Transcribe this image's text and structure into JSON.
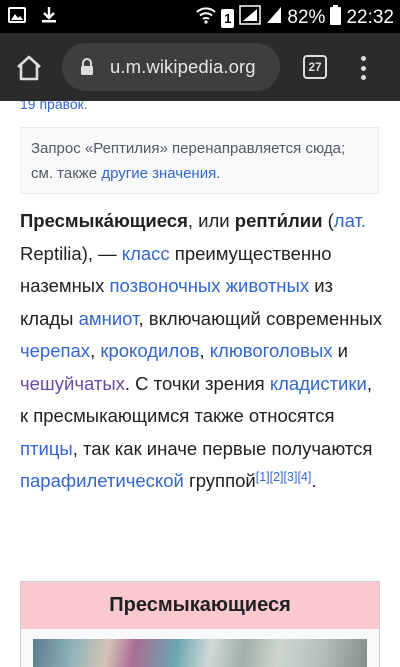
{
  "status_bar": {
    "battery": "82%",
    "time": "22:32",
    "sim": "1"
  },
  "browser": {
    "url": "u.m.wikipedia.org",
    "tab_count": "27"
  },
  "article": {
    "edits_link": "19 правок.",
    "hatnote": {
      "text": "Запрос «Рептилия» перенаправляется сюда; см. также ",
      "link": "другие значения",
      "end": "."
    },
    "para": {
      "t1": "Пресмыка́ющиеся",
      "t2": ", или ",
      "t3": "репти́лии",
      "t4": " (",
      "l_lat": "лат.",
      "t5": " Reptilia), — ",
      "l_class": "класс",
      "t6": " преимущественно наземных ",
      "l_vertebrates": "позвоночных животных",
      "t7": " из клады ",
      "l_amniotes": "амниот",
      "t8": ", включающий современных ",
      "l_turtles": "черепах",
      "t9": ", ",
      "l_crocodiles": "крокодилов",
      "t10": ", ",
      "l_rhynch": "клювоголовых",
      "t11": " и ",
      "l_squamata": "чешуйчатых",
      "t12": ". С точки зрения ",
      "l_cladistics": "кладистики",
      "t13": ", к пресмыкающимся также относятся ",
      "l_birds": "птицы",
      "t14": ", так как иначе первые получаются ",
      "l_paraphyletic": "парафилетической",
      "t15": " группой",
      "refs": [
        "[1]",
        "[2]",
        "[3]",
        "[4]"
      ],
      "t16": "."
    },
    "infobox_title": "Пресмыкающиеся"
  },
  "colors": {
    "link": "#3366cc",
    "visited_link": "#6b4ba1",
    "infobox_header": "#f9c9cf"
  },
  "icons": [
    "photo-icon",
    "download-icon",
    "wifi-icon",
    "sim-icon",
    "signal-icon",
    "battery-icon",
    "home-icon",
    "lock-icon",
    "tabs-icon",
    "more-vert-icon"
  ]
}
